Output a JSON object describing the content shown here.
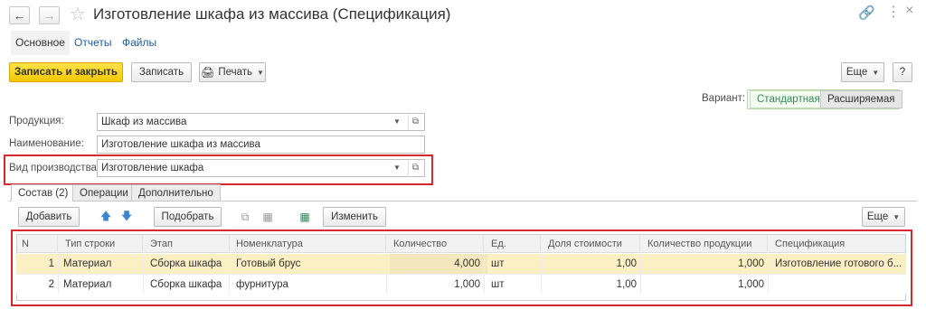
{
  "window": {
    "title": "Изготовление шкафа из массива (Спецификация)",
    "back_icon": "arrow-left-icon",
    "forward_icon": "arrow-right-icon",
    "favorite_icon": "star-icon",
    "link_icon": "link-icon",
    "more_icon": "more-icon",
    "close_icon": "close-icon"
  },
  "tabs": [
    "Основное",
    "Отчеты",
    "Файлы"
  ],
  "toolbar": {
    "save_close": "Записать и закрыть",
    "save": "Записать",
    "print": "Печать",
    "more": "Еще",
    "help": "?"
  },
  "variant": {
    "label": "Вариант:",
    "options": [
      "Стандартная",
      "Расширяемая"
    ],
    "selected": "Стандартная"
  },
  "form": {
    "product_label": "Продукция:",
    "product_value": "Шкаф из массива",
    "name_label": "Наименование:",
    "name_value": "Изготовление шкафа из массива",
    "prod_type_label": "Вид производства:",
    "prod_type_value": "Изготовление шкафа"
  },
  "inner_tabs": [
    "Состав (2)",
    "Операции",
    "Дополнительно"
  ],
  "table_toolbar": {
    "add": "Добавить",
    "pick": "Подобрать",
    "change": "Изменить",
    "more": "Еще"
  },
  "table": {
    "columns": [
      "N",
      "Тип строки",
      "Этап",
      "Номенклатура",
      "Количество",
      "Ед.",
      "Доля стоимости",
      "Количество продукции",
      "Спецификация"
    ],
    "rows": [
      [
        "1",
        "Материал",
        "Сборка шкафа",
        "Готовый брус",
        "4,000",
        "шт",
        "1,00",
        "1,000",
        "Изготовление готового б..."
      ],
      [
        "2",
        "Материал",
        "Сборка шкафа",
        "фурнитура",
        "1,000",
        "шт",
        "1,00",
        "1,000",
        ""
      ]
    ]
  },
  "colors": {
    "accent_yellow": "#f5c800",
    "selected_row": "#fbf0c4",
    "highlight_red": "#d7282f",
    "link_blue": "#1a5e9c",
    "variant_green": "#2e8b57"
  }
}
